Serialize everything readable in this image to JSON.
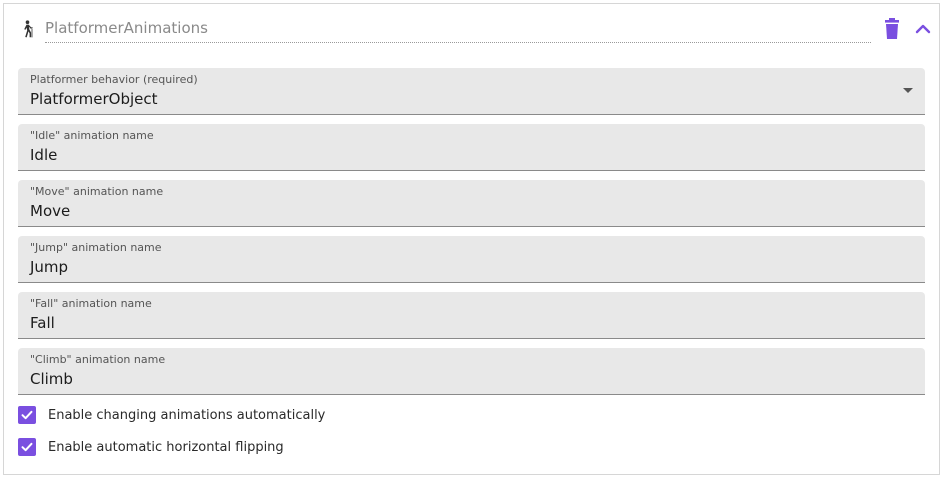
{
  "behavior": {
    "name": "PlatformerAnimations",
    "icon": "walking-person-icon",
    "delete_icon": "trash-icon",
    "collapse_icon": "chevron-up-icon",
    "accent_color": "#7a4fe0"
  },
  "fields": [
    {
      "label": "Platformer behavior (required)",
      "value": "PlatformerObject",
      "type": "select"
    },
    {
      "label": "\"Idle\" animation name",
      "value": "Idle",
      "type": "text"
    },
    {
      "label": "\"Move\" animation name",
      "value": "Move",
      "type": "text"
    },
    {
      "label": "\"Jump\" animation name",
      "value": "Jump",
      "type": "text"
    },
    {
      "label": "\"Fall\" animation name",
      "value": "Fall",
      "type": "text"
    },
    {
      "label": "\"Climb\" animation name",
      "value": "Climb",
      "type": "text"
    }
  ],
  "checkboxes": [
    {
      "label": "Enable changing animations automatically",
      "checked": true
    },
    {
      "label": "Enable automatic horizontal flipping",
      "checked": true
    }
  ]
}
